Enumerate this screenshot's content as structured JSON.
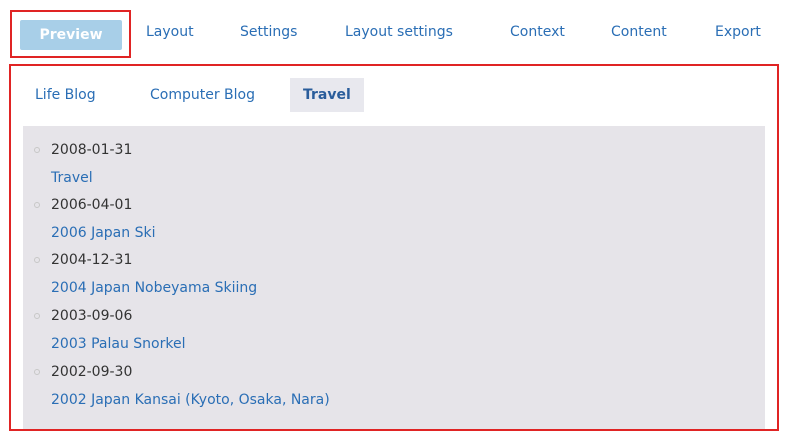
{
  "top_tabs": {
    "preview": "Preview",
    "layout": "Layout",
    "settings": "Settings",
    "layout_settings": "Layout settings",
    "context": "Context",
    "content": "Content",
    "export": "Export"
  },
  "sub_tabs": {
    "life_blog": "Life Blog",
    "computer_blog": "Computer Blog",
    "travel": "Travel"
  },
  "entries": [
    {
      "date": "2008-01-31",
      "title": "Travel"
    },
    {
      "date": "2006-04-01",
      "title": "2006 Japan Ski"
    },
    {
      "date": "2004-12-31",
      "title": "2004 Japan Nobeyama Skiing"
    },
    {
      "date": "2003-09-06",
      "title": "2003 Palau Snorkel"
    },
    {
      "date": "2002-09-30",
      "title": "2002 Japan Kansai (Kyoto, Osaka, Nara)"
    }
  ],
  "colors": {
    "highlight": "#e02424",
    "link": "#2a6eb5",
    "preview_bg": "#a8cfe8",
    "list_bg": "#e6e4e9"
  }
}
